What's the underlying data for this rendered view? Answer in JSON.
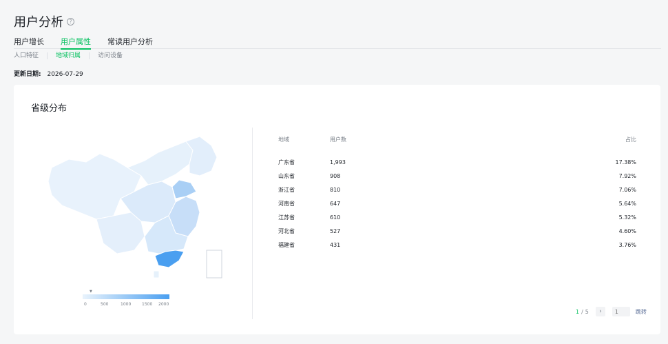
{
  "page": {
    "title": "用户分析",
    "help_icon": "question-circle-icon"
  },
  "tabs": [
    {
      "label": "用户增长",
      "active": false
    },
    {
      "label": "用户属性",
      "active": true
    },
    {
      "label": "常读用户分析",
      "active": false
    }
  ],
  "subtabs": [
    {
      "label": "人口特征",
      "active": false
    },
    {
      "label": "地域归属",
      "active": true
    },
    {
      "label": "访问设备",
      "active": false
    }
  ],
  "update": {
    "label": "更新日期:",
    "date": "2026-07-29"
  },
  "card": {
    "title": "省级分布"
  },
  "map": {
    "highlight_color": "#4a9ff0",
    "base_color": "#e6f1fb",
    "legend_ticks": [
      "0",
      "500",
      "1000",
      "1500",
      "2000"
    ]
  },
  "table": {
    "headers": [
      "地域",
      "用户数",
      "占比"
    ],
    "rows": [
      {
        "region": "广东省",
        "users": "1,993",
        "share": "17.38%"
      },
      {
        "region": "山东省",
        "users": "908",
        "share": "7.92%"
      },
      {
        "region": "浙江省",
        "users": "810",
        "share": "7.06%"
      },
      {
        "region": "河南省",
        "users": "647",
        "share": "5.64%"
      },
      {
        "region": "江苏省",
        "users": "610",
        "share": "5.32%"
      },
      {
        "region": "河北省",
        "users": "527",
        "share": "4.60%"
      },
      {
        "region": "福建省",
        "users": "431",
        "share": "3.76%"
      }
    ]
  },
  "pager": {
    "current": "1",
    "separator": "/",
    "total": "5",
    "next_icon": "chevron-right-icon",
    "input_placeholder": "1",
    "jump_label": "跳转"
  },
  "colors": {
    "accent": "#07c160",
    "link": "#576b95"
  }
}
